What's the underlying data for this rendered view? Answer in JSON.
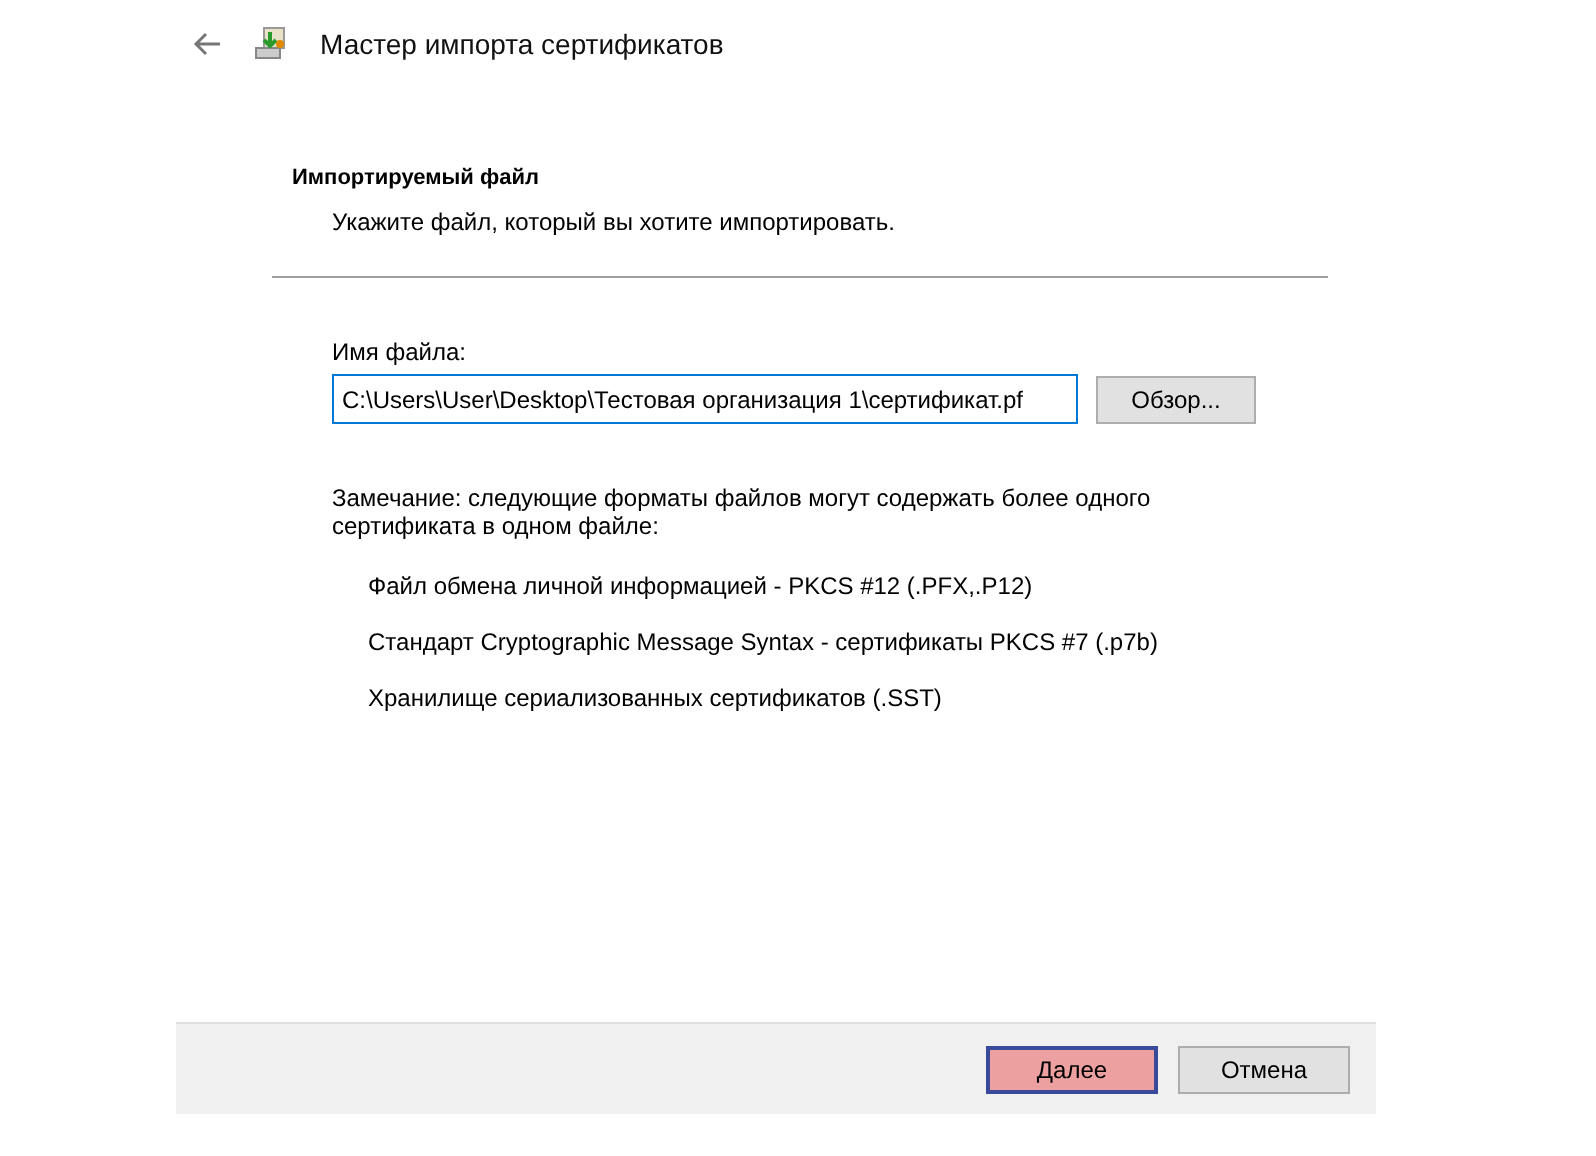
{
  "window": {
    "title": "Мастер импорта сертификатов"
  },
  "header": {
    "title": "Импортируемый файл",
    "subtitle": "Укажите файл, который вы хотите импортировать."
  },
  "file_field": {
    "label": "Имя файла:",
    "value": "C:\\Users\\User\\Desktop\\Тестовая организация 1\\сертификат.pf",
    "browse_button": "Обзор..."
  },
  "note": "Замечание: следующие форматы файлов могут содержать более одного сертификата в одном файле:",
  "formats": [
    "Файл обмена личной информацией - PKCS #12 (.PFX,.P12)",
    "Стандарт Cryptographic Message Syntax - сертификаты PKCS #7 (.p7b)",
    "Хранилище сериализованных сертификатов (.SST)"
  ],
  "buttons": [
    {
      "label": "Далее",
      "selected": true
    },
    {
      "label": "Отмена",
      "selected": false
    }
  ]
}
